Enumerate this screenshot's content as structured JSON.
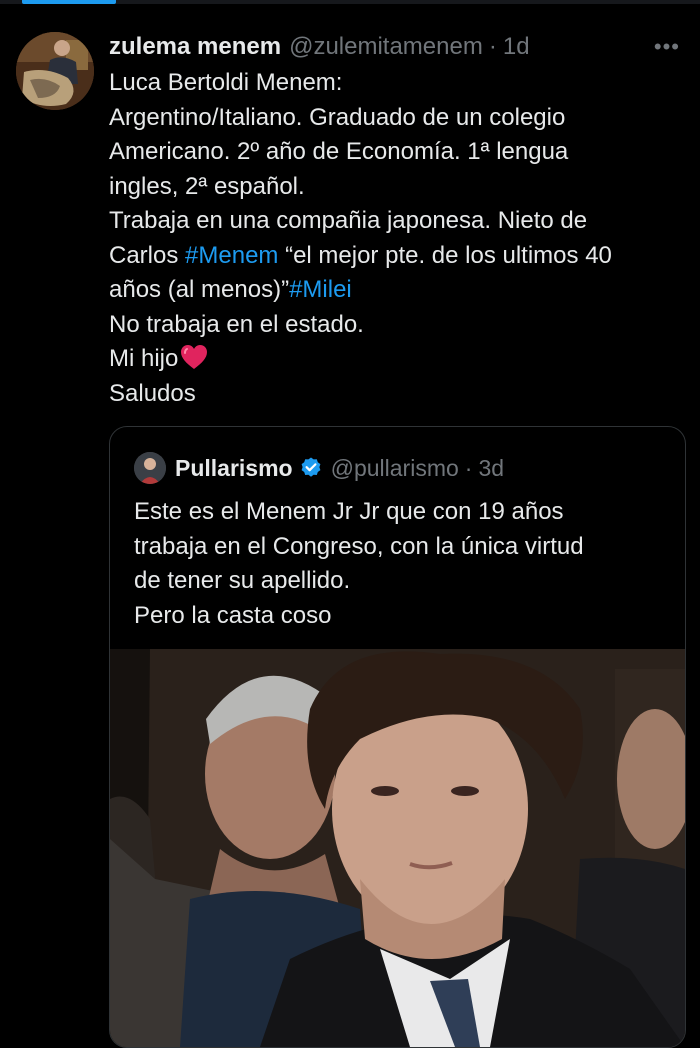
{
  "tweet": {
    "author_name": "zulema menem",
    "author_handle": "@zulemitamenem",
    "separator": "·",
    "time": "1d",
    "more_label": "•••",
    "lines": {
      "l1": "Luca Bertoldi Menem:",
      "l2": "Argentino/Italiano. Graduado de un colegio",
      "l3": "Americano. 2º año de Economía. 1ª lengua",
      "l4": "ingles, 2ª español.",
      "l5": "Trabaja en una compañia japonesa. Nieto de",
      "l6_pre": "Carlos ",
      "l6_tag": "#Menem",
      "l6_post": " “el mejor pte. de los ultimos 40",
      "l7_pre": "años (al menos)”",
      "l7_tag": "#Milei",
      "l8": "No trabaja en el estado.",
      "l9": "Mi hijo",
      "l10": "Saludos"
    }
  },
  "quote": {
    "author_name": "Pullarismo",
    "author_handle": "@pullarismo",
    "separator": "·",
    "time": "3d",
    "lines": [
      "Este es el Menem Jr Jr que con 19 años",
      "trabaja en el Congreso, con la única virtud",
      "de tener su apellido.",
      "Pero la casta coso"
    ]
  },
  "colors": {
    "background": "#000000",
    "text": "#e7e9ea",
    "secondary": "#71767b",
    "link": "#1d9bf0",
    "border": "#2f3336",
    "heart": "#e0245e"
  },
  "icons": {
    "more": "more-dots-icon",
    "verified": "verified-badge-icon",
    "heart": "red-heart-emoji-icon"
  }
}
